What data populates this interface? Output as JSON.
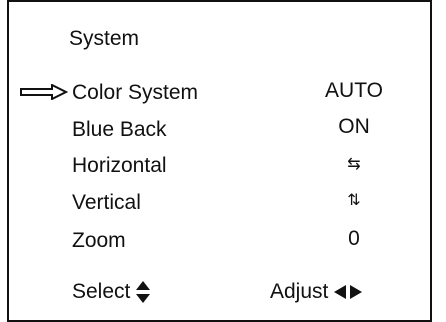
{
  "menu": {
    "title": "System",
    "items": [
      {
        "label": "Color System",
        "value": "AUTO"
      },
      {
        "label": "Blue Back",
        "value": "ON"
      },
      {
        "label": "Horizontal",
        "value": "⇆"
      },
      {
        "label": "Vertical",
        "value": "⇅"
      },
      {
        "label": "Zoom",
        "value": "0"
      }
    ]
  },
  "footer": {
    "select_label": "Select",
    "select_icon": "up-down-triangles-icon",
    "adjust_label": "Adjust",
    "adjust_icon": "left-right-triangles-icon"
  },
  "icons": {
    "pointer": "outline-right-arrow-icon"
  }
}
